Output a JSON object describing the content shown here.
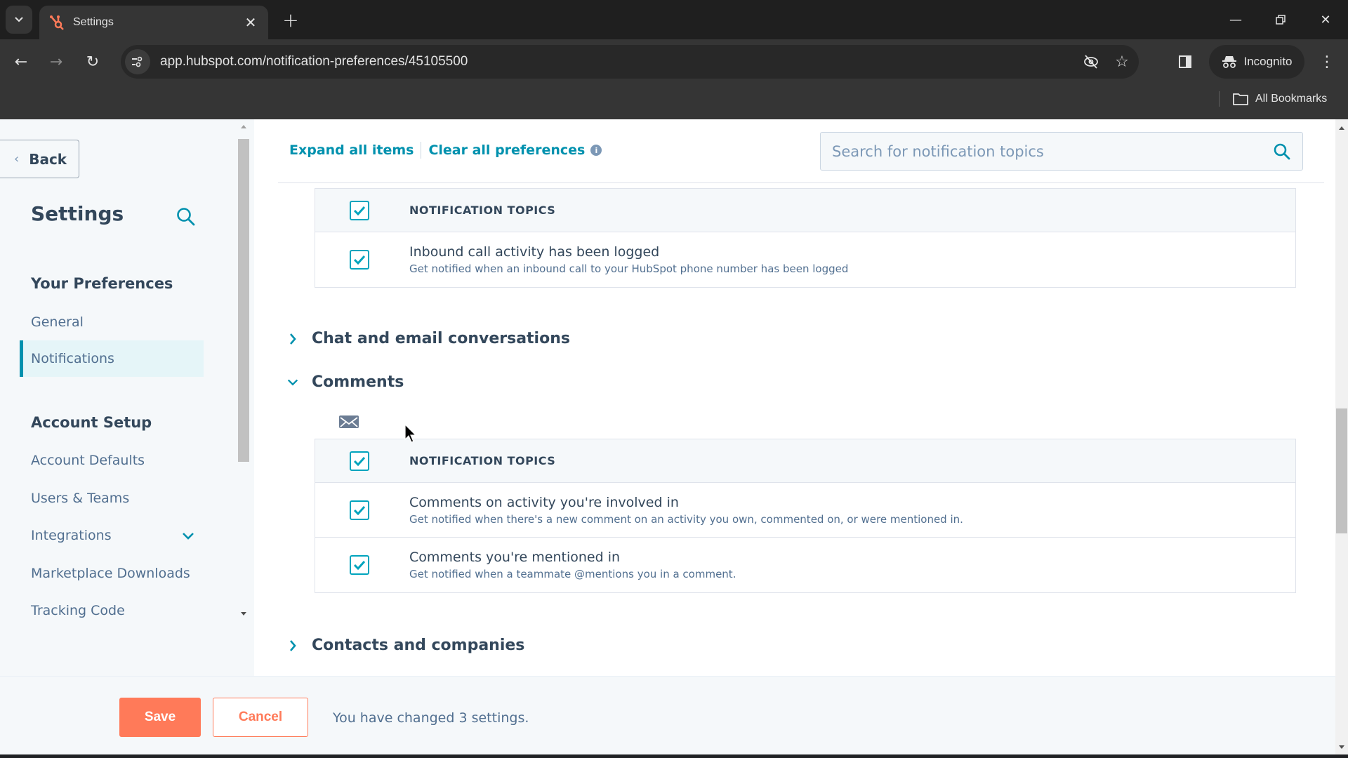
{
  "browser": {
    "tab_title": "Settings",
    "url": "app.hubspot.com/notification-preferences/45105500",
    "incognito_label": "Incognito",
    "all_bookmarks_label": "All Bookmarks"
  },
  "sidebar": {
    "back_label": "Back",
    "title": "Settings",
    "sections": [
      {
        "heading": "Your Preferences",
        "items": [
          {
            "label": "General",
            "active": false
          },
          {
            "label": "Notifications",
            "active": true
          }
        ]
      },
      {
        "heading": "Account Setup",
        "items": [
          {
            "label": "Account Defaults",
            "active": false
          },
          {
            "label": "Users & Teams",
            "active": false
          },
          {
            "label": "Integrations",
            "active": false,
            "expandable": true
          },
          {
            "label": "Marketplace Downloads",
            "active": false
          },
          {
            "label": "Tracking Code",
            "active": false
          }
        ]
      }
    ]
  },
  "main": {
    "expand_all_label": "Expand all items",
    "clear_all_label": "Clear all preferences",
    "search_placeholder": "Search for notification topics",
    "calls_table": {
      "header": "NOTIFICATION TOPICS",
      "header_checked": true,
      "rows": [
        {
          "name": "Inbound call activity has been logged",
          "description": "Get notified when an inbound call to your HubSpot phone number has been logged",
          "checked": true
        }
      ]
    },
    "categories": [
      {
        "label": "Chat and email conversations",
        "expanded": false
      },
      {
        "label": "Comments",
        "expanded": true
      },
      {
        "label": "Contacts and companies",
        "expanded": false
      }
    ],
    "comments_table": {
      "channel_icon": "email-icon",
      "header": "NOTIFICATION TOPICS",
      "header_checked": true,
      "rows": [
        {
          "name": "Comments on activity you're involved in",
          "description": "Get notified when there's a new comment on an activity you own, commented on, or were mentioned in.",
          "checked": true
        },
        {
          "name": "Comments you're mentioned in",
          "description": "Get notified when a teammate @mentions you in a comment.",
          "checked": true
        }
      ]
    }
  },
  "footer": {
    "save_label": "Save",
    "cancel_label": "Cancel",
    "status_text": "You have changed 3 settings."
  },
  "colors": {
    "accent_teal": "#0091ae",
    "checkbox_teal": "#00a4bd",
    "primary_orange": "#ff7a59",
    "text_dark": "#33475b"
  }
}
